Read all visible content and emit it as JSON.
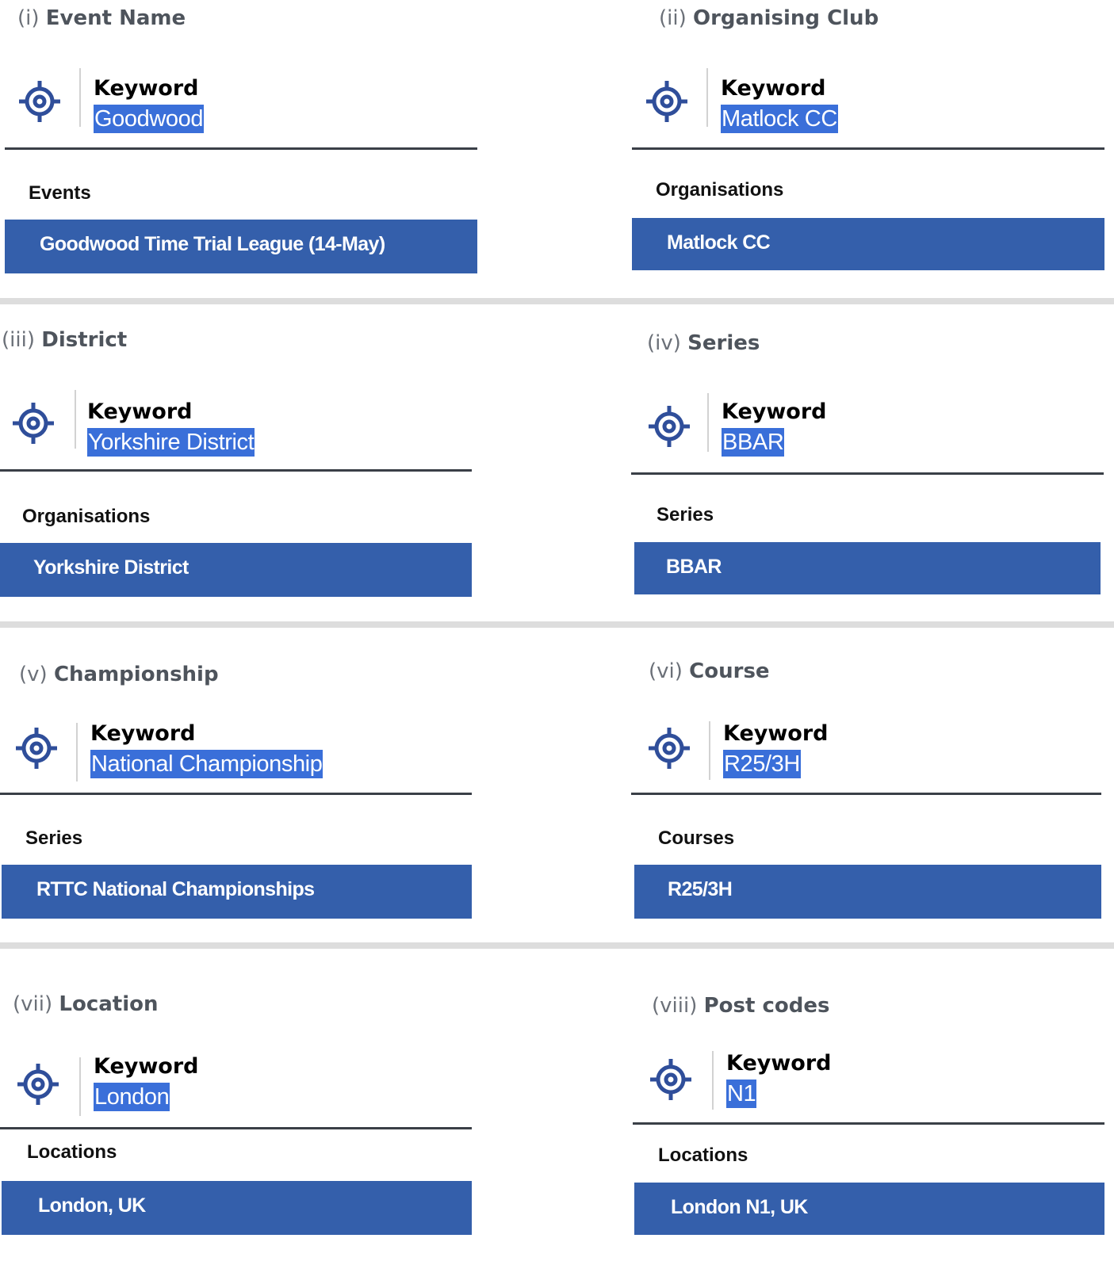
{
  "colors": {
    "accent": "#345fab",
    "highlight": "#3a6fd9",
    "icon": "#2f4e9a",
    "separator": "#dddddd"
  },
  "panels": [
    {
      "number": "(i)",
      "title": "Event Name",
      "keyword_label": "Keyword",
      "keyword": "Goodwood",
      "category": "Events",
      "result": "Goodwood Time Trial League (14-May)",
      "icon": "target-icon"
    },
    {
      "number": "(ii)",
      "title": "Organising Club",
      "keyword_label": "Keyword",
      "keyword": "Matlock CC",
      "category": "Organisations",
      "result": "Matlock CC",
      "icon": "target-icon"
    },
    {
      "number": "(iii)",
      "title": "District",
      "keyword_label": "Keyword",
      "keyword": "Yorkshire District",
      "category": "Organisations",
      "result": "Yorkshire District",
      "icon": "target-icon"
    },
    {
      "number": "(iv)",
      "title": "Series",
      "keyword_label": "Keyword",
      "keyword": "BBAR",
      "category": "Series",
      "result": "BBAR",
      "icon": "target-icon"
    },
    {
      "number": "(v)",
      "title": "Championship",
      "keyword_label": "Keyword",
      "keyword": "National Championship",
      "category": "Series",
      "result": "RTTC National Championships",
      "icon": "target-icon"
    },
    {
      "number": "(vi)",
      "title": "Course",
      "keyword_label": "Keyword",
      "keyword": "R25/3H",
      "category": "Courses",
      "result": "R25/3H",
      "icon": "target-icon"
    },
    {
      "number": "(vii)",
      "title": "Location",
      "keyword_label": "Keyword",
      "keyword": "London",
      "category": "Locations",
      "result": "London, UK",
      "icon": "target-icon"
    },
    {
      "number": "(viii)",
      "title": "Post codes",
      "keyword_label": "Keyword",
      "keyword": "N1",
      "category": "Locations",
      "result": "London N1, UK",
      "icon": "target-icon"
    }
  ]
}
